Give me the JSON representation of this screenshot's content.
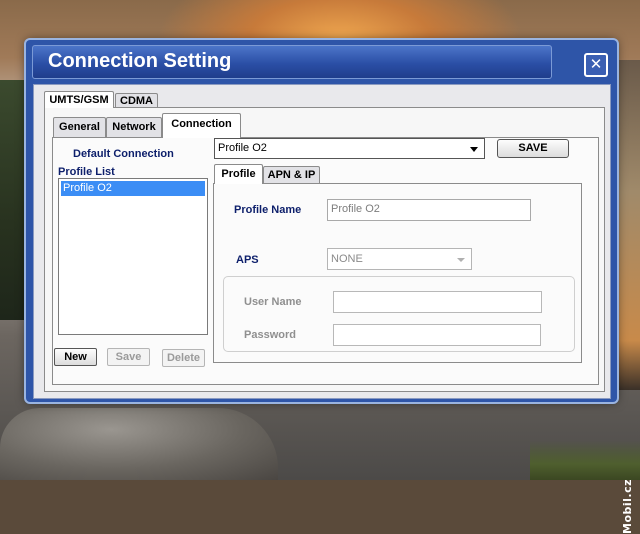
{
  "window": {
    "title": "Connection Setting",
    "close_glyph": "✕"
  },
  "network_tabs": [
    {
      "label": "UMTS/GSM",
      "active": true
    },
    {
      "label": "CDMA",
      "active": false
    }
  ],
  "section_tabs": [
    {
      "label": "General",
      "active": false
    },
    {
      "label": "Network",
      "active": false
    },
    {
      "label": "Connection",
      "active": true
    }
  ],
  "left_panel": {
    "default_connection_label": "Default Connection",
    "profile_list_label": "Profile List",
    "profiles": [
      "Profile O2"
    ],
    "selected_profile": "Profile O2",
    "buttons": {
      "new": "New",
      "save": "Save",
      "delete": "Delete"
    }
  },
  "default_connection": {
    "selected": "Profile O2",
    "save_button": "SAVE"
  },
  "profile_tabs": [
    {
      "label": "Profile",
      "active": true
    },
    {
      "label": "APN & IP",
      "active": false
    }
  ],
  "profile_form": {
    "profile_name_label": "Profile Name",
    "profile_name_value": "Profile O2",
    "aps_label": "APS",
    "aps_value": "NONE",
    "user_name_label": "User Name",
    "user_name_value": "",
    "password_label": "Password",
    "password_value": ""
  },
  "watermark": "Mobil.cz",
  "colors": {
    "title_bar": "#2b4fa6",
    "selection": "#3b8df5",
    "label_blue": "#0d1f6b"
  }
}
